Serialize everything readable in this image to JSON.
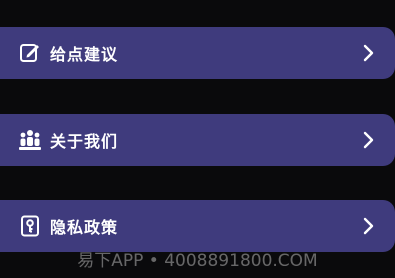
{
  "menu": {
    "items": [
      {
        "label": "给点建议",
        "icon": "edit-icon"
      },
      {
        "label": "关于我们",
        "icon": "team-icon"
      },
      {
        "label": "隐私政策",
        "icon": "privacy-key-icon"
      }
    ]
  },
  "watermark": {
    "text": "易下APP • 4008891800.COM"
  },
  "colors": {
    "background": "#0a0a0c",
    "row_background": "#3f3b7d",
    "text": "#ffffff"
  }
}
